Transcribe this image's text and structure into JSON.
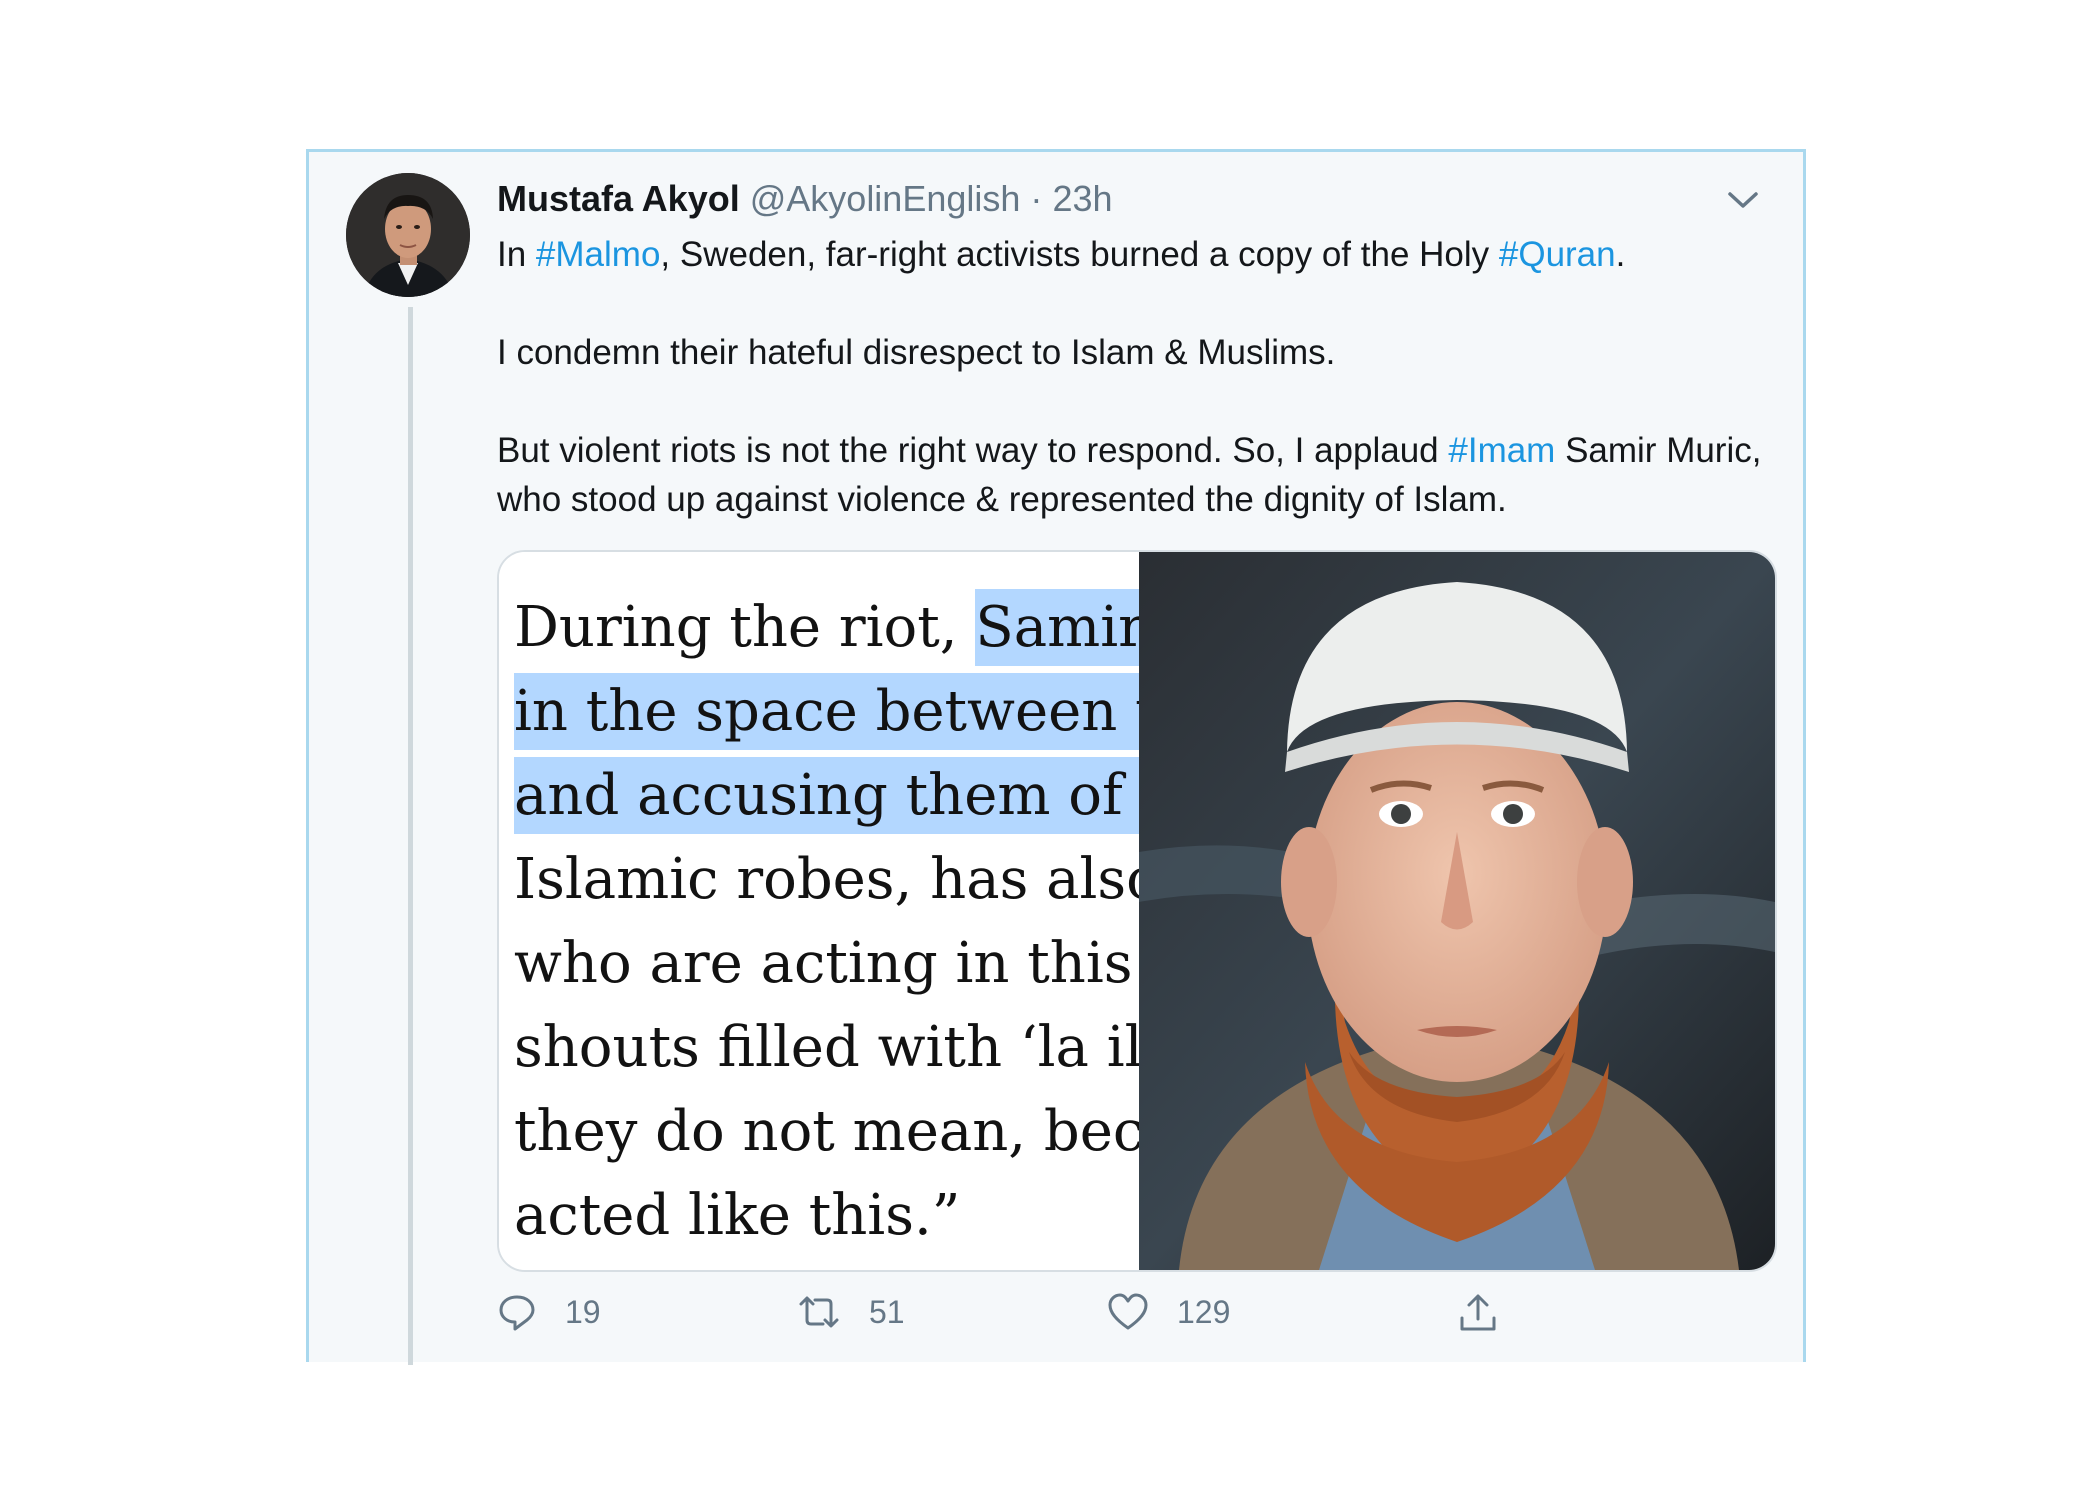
{
  "tweet": {
    "author_name": "Mustafa Akyol",
    "author_handle": "@AkyolinEnglish",
    "separator": "·",
    "time": "23h",
    "paragraph1": {
      "t1": "In ",
      "h1": "#Malmo",
      "t2": ", Sweden, far-right activists burned a copy of the Holy ",
      "h2": "#Quran",
      "t3": "."
    },
    "paragraph2": "I condemn their hateful disrespect to Islam & Muslims.",
    "paragraph3": {
      "t1": "But violent riots is not the right way to respond. So, I applaud ",
      "h1": "#Imam",
      "t2": " Samir Muric, who stood up against violence & represented the dignity of Islam."
    },
    "icons": {
      "menu": "chevron-down-icon",
      "reply": "reply-icon",
      "retweet": "retweet-icon",
      "like": "heart-icon",
      "share": "share-icon"
    }
  },
  "media": {
    "quote_lines": [
      {
        "pre": "During the riot, ",
        "hl": "Samir M"
      },
      {
        "pre": "",
        "hl": "in the space between th"
      },
      {
        "pre": "",
        "hl": "and accusing them of sl"
      },
      {
        "pre": "Islamic robes, has also c",
        "hl": ""
      },
      {
        "pre": "who are acting in this w",
        "hl": ""
      },
      {
        "pre": "shouts filled with ‘la ila",
        "hl": ""
      },
      {
        "pre": "they do not mean, beca",
        "hl": ""
      },
      {
        "pre": "acted like this.”",
        "hl": ""
      }
    ],
    "photo": "portrait-photo"
  },
  "actions": {
    "replies": "19",
    "retweets": "51",
    "likes": "129"
  },
  "colors": {
    "hashtag": "#1b95e0",
    "muted": "#657786",
    "selection": "#b3d7ff",
    "tweet_bg": "#f5f8fa",
    "border": "#a9d8ee"
  }
}
